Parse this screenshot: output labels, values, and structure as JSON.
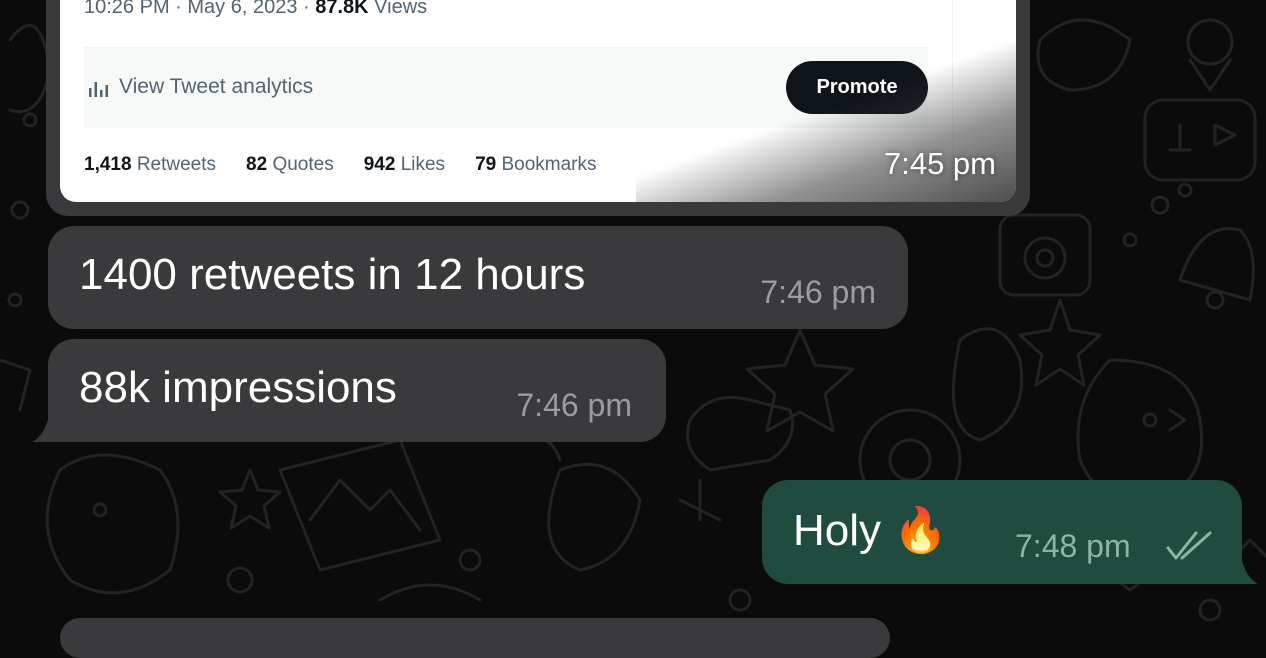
{
  "tweet_card": {
    "meta_time": "10:26 PM · May 6, 2023 · ",
    "meta_views_count": "87.8K",
    "meta_views_label": " Views",
    "analytics_label": "View Tweet analytics",
    "promote_label": "Promote",
    "stats": [
      {
        "count": "1,418",
        "label": " Retweets"
      },
      {
        "count": "82",
        "label": " Quotes"
      },
      {
        "count": "942",
        "label": " Likes"
      },
      {
        "count": "79",
        "label": " Bookmarks"
      }
    ],
    "time": "7:45 pm"
  },
  "messages": [
    {
      "direction": "incoming",
      "text": "1400 retweets in 12 hours",
      "time": "7:46 pm"
    },
    {
      "direction": "incoming",
      "text": "88k impressions",
      "time": "7:46 pm"
    },
    {
      "direction": "outgoing",
      "text": "Holy 🔥",
      "time": "7:48 pm",
      "status_icon": "double-check-icon"
    }
  ],
  "colors": {
    "background": "#0b0b0b",
    "incoming_bubble": "#3a3a3c",
    "outgoing_bubble": "#1f4c3f",
    "tweet_promote_button": "#0f1419"
  }
}
